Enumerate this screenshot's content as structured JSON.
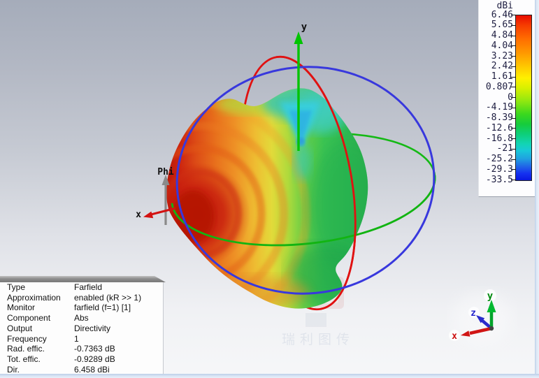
{
  "legend": {
    "title": "dBi",
    "ticks": [
      "6.46",
      "5.65",
      "4.84",
      "4.04",
      "3.23",
      "2.42",
      "1.61",
      "0.807",
      "0",
      "-4.19",
      "-8.39",
      "-12.6",
      "-16.8",
      "-21",
      "-25.2",
      "-29.3",
      "-33.5"
    ]
  },
  "scene": {
    "y_axis_label": "y",
    "phi_label": "Phi",
    "x_axis_label": "x"
  },
  "orientation_widget": {
    "x_label": "x",
    "y_label": "y",
    "z_label": "z"
  },
  "watermark": {
    "text": "瑞利图传"
  },
  "info_table": {
    "rows": [
      {
        "label": "Type",
        "value": "Farfield"
      },
      {
        "label": "Approximation",
        "value": "enabled (kR >> 1)"
      },
      {
        "label": "Monitor",
        "value": "farfield (f=1) [1]"
      },
      {
        "label": "Component",
        "value": "Abs"
      },
      {
        "label": "Output",
        "value": "Directivity"
      },
      {
        "label": "Frequency",
        "value": "1"
      },
      {
        "label": "Rad. effic.",
        "value": "-0.7363 dB"
      },
      {
        "label": "Tot. effic.",
        "value": "-0.9289 dB"
      },
      {
        "label": "Dir.",
        "value": "6.458 dBi"
      }
    ]
  },
  "colors": {
    "axis_x": "#d31212",
    "axis_y": "#00c400",
    "axis_z": "#2a2acb",
    "ring_red": "#e01111",
    "ring_green": "#15b915",
    "ring_blue": "#3838dd",
    "legend_max": "#e80c00",
    "legend_min": "#0a18e0",
    "pattern_peak": "#c01408"
  }
}
